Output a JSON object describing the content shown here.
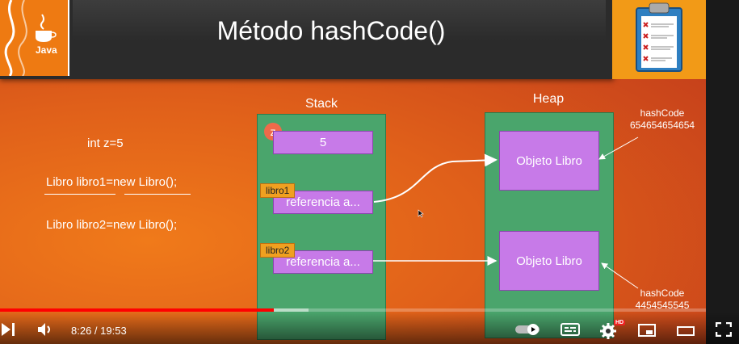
{
  "slide": {
    "title": "Método hashCode()",
    "code_lines": [
      "int z=5",
      "Libro libro1=new Libro();",
      "Libro libro2=new Libro();"
    ],
    "stack": {
      "title": "Stack",
      "var_badge": "z",
      "z_value": "5",
      "ref1_tag": "libro1",
      "ref1_text": "referencia a...",
      "ref2_tag": "libro2",
      "ref2_text": "referencia a..."
    },
    "heap": {
      "title": "Heap",
      "obj1": "Objeto Libro",
      "obj2": "Objeto Libro"
    },
    "hash1": {
      "label": "hashCode",
      "value": "654654654654"
    },
    "hash2": {
      "label": "hashCode",
      "value": "4454545545"
    }
  },
  "player": {
    "time": "8:26 / 19:53",
    "progress": 0.388,
    "buffered": 0.437,
    "hd_badge": "HD",
    "icons": [
      "next-icon",
      "volume-icon",
      "autoplay-toggle-icon",
      "subtitles-icon",
      "settings-icon",
      "miniplayer-icon",
      "theater-icon",
      "fullscreen-icon"
    ]
  },
  "colors": {
    "accent": "#ff0000",
    "stack": "#4aa56c",
    "cell": "#c77ae8",
    "tag": "#f0a020"
  }
}
